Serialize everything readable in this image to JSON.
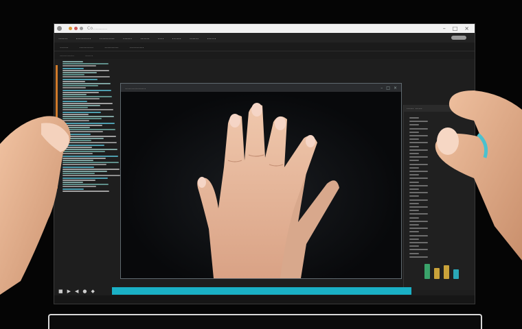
{
  "window": {
    "title": "Co..........",
    "controls": [
      "–",
      "□",
      "×"
    ]
  },
  "menubar": {
    "items": [
      "......",
      "..........",
      "..........",
      "......",
      "......",
      "....",
      "......",
      "......",
      "......"
    ]
  },
  "toolbar": {
    "items": [
      "......",
      "..........",
      "..........",
      "..........",
      "...........",
      "......"
    ]
  },
  "preview": {
    "header": "................",
    "controls": [
      "–",
      "□",
      "×"
    ]
  },
  "right_panel": {
    "header": "...... ......"
  },
  "colors": {
    "accent": "#1ab0c5",
    "orange": "#d07a2a",
    "skin": "#e7b89a"
  },
  "bottom": {
    "icons": [
      "■",
      "▶",
      "◀",
      "●",
      "◆"
    ]
  }
}
